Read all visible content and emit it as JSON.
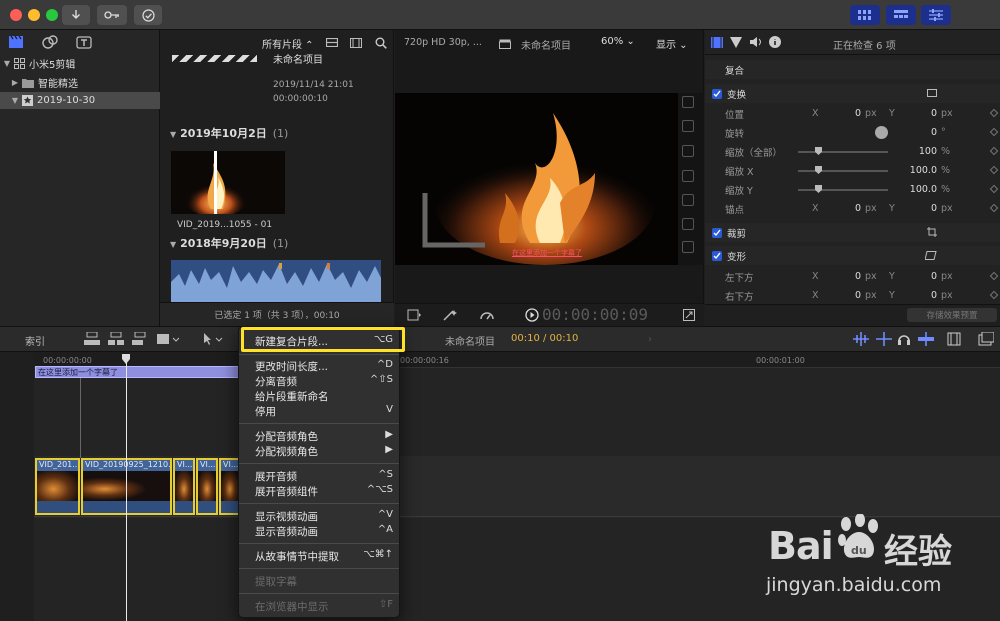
{
  "titlebar": {
    "icons": [
      "download-icon",
      "key-icon",
      "check-circle-icon",
      "grid-view-icon",
      "list-view-icon",
      "sliders-icon"
    ]
  },
  "libraries": {
    "items": [
      {
        "label": "小米5剪辑"
      },
      {
        "label": "智能精选"
      },
      {
        "label": "2019-10-30"
      }
    ]
  },
  "browser": {
    "filter": "所有片段 ⌃",
    "project_title": "未命名项目",
    "project_date": "2019/11/14 21:01",
    "project_duration": "00:00:00:10",
    "groups": [
      {
        "date": "2019年10月2日",
        "count": "(1)",
        "clip": "VID_2019...1055 - 01"
      },
      {
        "date": "2018年9月20日",
        "count": "(1)"
      }
    ],
    "status": "已选定 1 项（共 3 项），00:10"
  },
  "viewer": {
    "format": "720p HD 30p, ...",
    "project": "未命名项目",
    "zoom": "60% ⌄",
    "display": "显示 ⌄",
    "subtitle": "在这里添加一个字幕了",
    "timecode": "00:00:00:09"
  },
  "inspector": {
    "status": "正在检查 6 项",
    "blend": "复合",
    "transform": "变换",
    "position_label": "位置",
    "position_x": "0",
    "position_y": "0",
    "rotation_label": "旋转",
    "rotation_val": "0",
    "scale_all_label": "缩放（全部）",
    "scale_all_val": "100",
    "scale_x_label": "缩放 X",
    "scale_x_val": "100.0",
    "scale_y_label": "缩放 Y",
    "scale_y_val": "100.0",
    "anchor_label": "锚点",
    "anchor_x": "0",
    "anchor_y": "0",
    "crop": "裁剪",
    "distort": "变形",
    "bottom_left_label": "左下方",
    "bottom_left_x": "0",
    "bottom_left_y": "0",
    "bottom_right_label": "右下方",
    "bottom_right_x": "0",
    "bottom_right_y": "0",
    "save_preset": "存储效果预置",
    "unit_px": "px",
    "unit_pct": "%",
    "unit_deg": "°",
    "axis_x": "X",
    "axis_y": "Y"
  },
  "timeline": {
    "index_label": "索引",
    "project": "未命名项目",
    "timecode": "00:10 / 00:10",
    "ruler": [
      "00:00:00:00",
      "00:00:00:16",
      "00:00:01:00"
    ],
    "title_clip": "在这里添加一个字幕了",
    "clips": [
      "VID_201...",
      "VID_20190925_1210...",
      "VI...",
      "VI...",
      "VI..."
    ]
  },
  "context_menu": {
    "items": [
      {
        "label": "新建复合片段...",
        "shortcut": "⌥G"
      },
      {
        "label": "更改时间长度...",
        "shortcut": "^D"
      },
      {
        "label": "分离音频",
        "shortcut": "^⇧S"
      },
      {
        "label": "给片段重新命名",
        "shortcut": ""
      },
      {
        "label": "停用",
        "shortcut": "V"
      },
      {
        "label": "分配音频角色",
        "shortcut": "▶"
      },
      {
        "label": "分配视频角色",
        "shortcut": "▶"
      },
      {
        "label": "展开音频",
        "shortcut": "^S"
      },
      {
        "label": "展开音频组件",
        "shortcut": "^⌥S"
      },
      {
        "label": "显示视频动画",
        "shortcut": "^V"
      },
      {
        "label": "显示音频动画",
        "shortcut": "^A"
      },
      {
        "label": "从故事情节中提取",
        "shortcut": "⌥⌘↑"
      },
      {
        "label": "提取字幕",
        "shortcut": ""
      },
      {
        "label": "在浏览器中显示",
        "shortcut": "⇧F"
      }
    ]
  },
  "watermark": {
    "brand_a": "Bai",
    "brand_b": "经验",
    "url": "jingyan.baidu.com"
  },
  "colors": {
    "accent": "#2a5bd7",
    "highlight": "#ffe227",
    "clip_yellow": "#e6cc2a",
    "title_purple": "#8f8fe0"
  }
}
